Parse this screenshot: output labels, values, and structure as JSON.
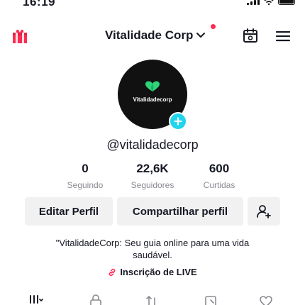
{
  "status_bar": {
    "time": "16:19"
  },
  "header": {
    "account_name": "Vitalidade Corp"
  },
  "profile": {
    "avatar_text": "Vitalidadecorp",
    "username": "@vitalidadecorp"
  },
  "stats": [
    {
      "value": "0",
      "label": "Seguindo"
    },
    {
      "value": "22,6K",
      "label": "Seguidores"
    },
    {
      "value": "600",
      "label": "Curtidas"
    }
  ],
  "actions": {
    "edit_label": "Editar Perfil",
    "share_label": "Compartilhar perfil"
  },
  "bio": "\"VitalidadeCorp: Seu guia online para uma vida saudável.",
  "live_link": {
    "label": "Inscrição de LIVE"
  },
  "colors": {
    "accent": "#fe2c55",
    "badge": "#20d5ec",
    "logo": "#2fd37a",
    "button_bg": "#f1f1f2"
  },
  "icons": {
    "top_left": "gift-icon",
    "top_right": [
      "calendar-icon",
      "menu-icon"
    ],
    "tabs": [
      "grid-icon",
      "lock-icon",
      "repost-icon",
      "saved-icon",
      "liked-icon"
    ]
  }
}
